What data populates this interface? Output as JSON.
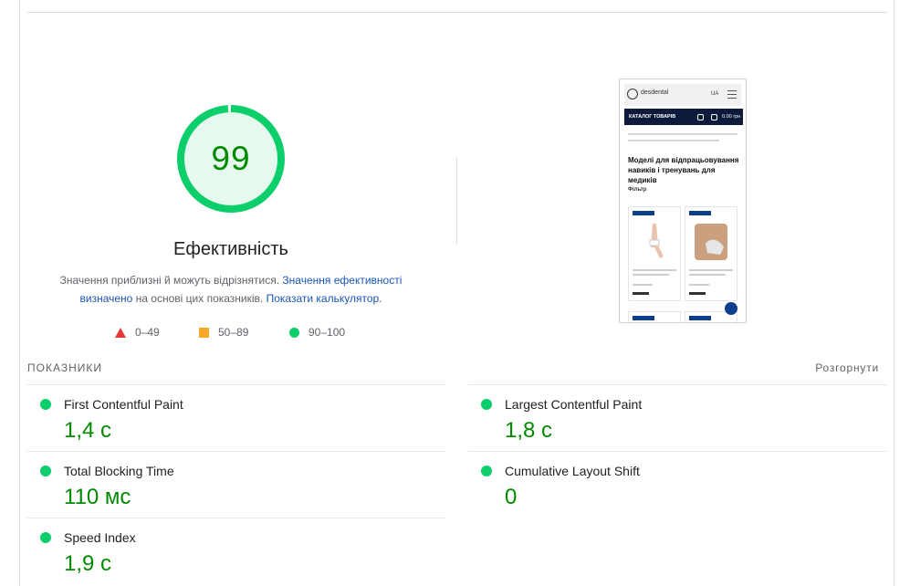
{
  "gauge": {
    "score": "99",
    "score_fraction": 0.99,
    "title": "Ефективність",
    "desc_prefix": "Значення приблизні й можуть відрізнятися.",
    "desc_link1": "Значення ефективності визначено",
    "desc_middle": "на основі цих показників.",
    "desc_link2": "Показати калькулятор",
    "desc_suffix": ".",
    "colors": {
      "pass": "#0cce6b",
      "pass_text": "#008a00",
      "pass_bg": "#e6f9ee"
    }
  },
  "legend": [
    {
      "icon": "red-triangle-icon",
      "label": "0–49"
    },
    {
      "icon": "orange-square-icon",
      "label": "50–89"
    },
    {
      "icon": "green-circle-icon",
      "label": "90–100"
    }
  ],
  "screenshot": {
    "brand": "desdental",
    "lang": "UA",
    "nav_label": "КАТАЛОГ ТОВАРІВ",
    "cart_total": "0.00 грн",
    "page_title": "Моделі для відпрацьовування навиків і тренувань для медиків",
    "filter_label": "Фільтр"
  },
  "metrics": {
    "label": "ПОКАЗНИКИ",
    "expand_label": "Розгорнути",
    "items": [
      {
        "name": "First Contentful Paint",
        "value": "1,4 с"
      },
      {
        "name": "Largest Contentful Paint",
        "value": "1,8 с"
      },
      {
        "name": "Total Blocking Time",
        "value": "110 мс"
      },
      {
        "name": "Cumulative Layout Shift",
        "value": "0"
      },
      {
        "name": "Speed Index",
        "value": "1,9 с"
      }
    ]
  }
}
